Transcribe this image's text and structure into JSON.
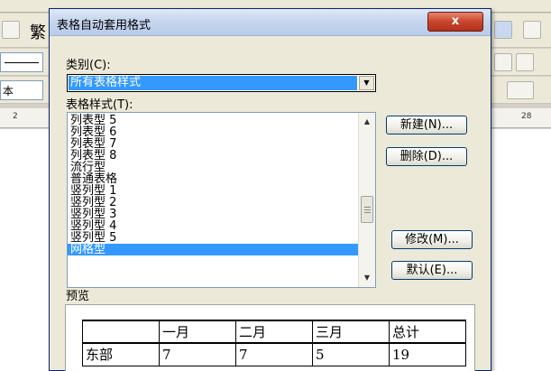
{
  "background": {
    "trad_char": "繁",
    "font_value": "本",
    "ruler_left": "2",
    "ruler_right": "28"
  },
  "dialog": {
    "title": "表格自动套用格式",
    "close_label": "x",
    "category_label": "类别(C):",
    "category_value": "所有表格样式",
    "styles_label": "表格样式(T):",
    "style_items": [
      "列表型 5",
      "列表型 6",
      "列表型 7",
      "列表型 8",
      "流行型",
      "普通表格",
      "竖列型 1",
      "竖列型 2",
      "竖列型 3",
      "竖列型 4",
      "竖列型 5",
      "网格型"
    ],
    "selected_index": 11,
    "buttons": {
      "new": "新建(N)...",
      "delete": "删除(D)...",
      "modify": "修改(M)...",
      "default": "默认(E)..."
    },
    "preview_label": "预览",
    "preview_table": {
      "header": [
        "",
        "一月",
        "二月",
        "三月",
        "总计"
      ],
      "row1": [
        "东部",
        "7",
        "7",
        "5",
        "19"
      ]
    }
  },
  "colors": {
    "selection": "#3399ff",
    "dialog_bg": "#ece9d8",
    "close_red": "#c8452c"
  }
}
